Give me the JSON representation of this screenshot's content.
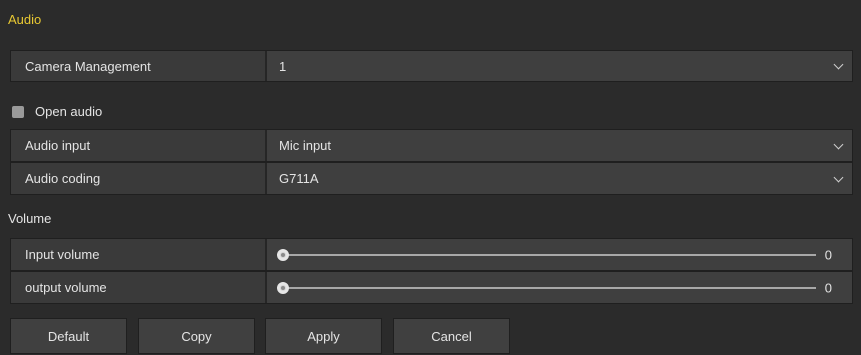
{
  "section": {
    "title": "Audio"
  },
  "camera_management": {
    "label": "Camera Management",
    "value": "1"
  },
  "open_audio": {
    "label": "Open audio",
    "checked": false
  },
  "audio_input": {
    "label": "Audio input",
    "value": "Mic input"
  },
  "audio_coding": {
    "label": "Audio coding",
    "value": "G711A"
  },
  "volume": {
    "heading": "Volume",
    "input": {
      "label": "Input volume",
      "value": "0"
    },
    "output": {
      "label": "output volume",
      "value": "0"
    }
  },
  "buttons": {
    "default": "Default",
    "copy": "Copy",
    "apply": "Apply",
    "cancel": "Cancel"
  },
  "colors": {
    "title": "#e8c832",
    "background": "#2b2b2b"
  }
}
